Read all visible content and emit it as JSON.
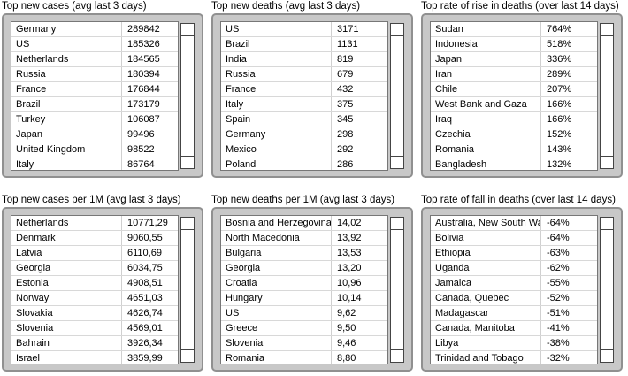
{
  "panels": [
    {
      "title": "Top new cases (avg last 3 days)",
      "rows": [
        [
          "Germany",
          "289842"
        ],
        [
          "US",
          "185326"
        ],
        [
          "Netherlands",
          "184565"
        ],
        [
          "Russia",
          "180394"
        ],
        [
          "France",
          "176844"
        ],
        [
          "Brazil",
          "173179"
        ],
        [
          "Turkey",
          "106087"
        ],
        [
          "Japan",
          "99496"
        ],
        [
          "United Kingdom",
          "98522"
        ],
        [
          "Italy",
          "86764"
        ]
      ]
    },
    {
      "title": "Top new deaths (avg last 3 days)",
      "rows": [
        [
          "US",
          "3171"
        ],
        [
          "Brazil",
          "1131"
        ],
        [
          "India",
          "819"
        ],
        [
          "Russia",
          "679"
        ],
        [
          "France",
          "432"
        ],
        [
          "Italy",
          "375"
        ],
        [
          "Spain",
          "345"
        ],
        [
          "Germany",
          "298"
        ],
        [
          "Mexico",
          "292"
        ],
        [
          "Poland",
          "286"
        ]
      ]
    },
    {
      "title": "Top rate of rise in deaths (over last 14 days)",
      "rows": [
        [
          "Sudan",
          "764%"
        ],
        [
          "Indonesia",
          "518%"
        ],
        [
          "Japan",
          "336%"
        ],
        [
          "Iran",
          "289%"
        ],
        [
          "Chile",
          "207%"
        ],
        [
          "West Bank and Gaza",
          "166%"
        ],
        [
          "Iraq",
          "166%"
        ],
        [
          "Czechia",
          "152%"
        ],
        [
          "Romania",
          "143%"
        ],
        [
          "Bangladesh",
          "132%"
        ]
      ]
    },
    {
      "title": "Top new cases per 1M (avg last 3 days)",
      "rows": [
        [
          "Netherlands",
          "10771,29"
        ],
        [
          "Denmark",
          "9060,55"
        ],
        [
          "Latvia",
          "6110,69"
        ],
        [
          "Georgia",
          "6034,75"
        ],
        [
          "Estonia",
          "4908,51"
        ],
        [
          "Norway",
          "4651,03"
        ],
        [
          "Slovakia",
          "4626,74"
        ],
        [
          "Slovenia",
          "4569,01"
        ],
        [
          "Bahrain",
          "3926,34"
        ],
        [
          "Israel",
          "3859,99"
        ]
      ]
    },
    {
      "title": "Top new deaths per 1M (avg last 3 days)",
      "rows": [
        [
          "Bosnia and Herzegovina",
          "14,02"
        ],
        [
          "North Macedonia",
          "13,92"
        ],
        [
          "Bulgaria",
          "13,53"
        ],
        [
          "Georgia",
          "13,20"
        ],
        [
          "Croatia",
          "10,96"
        ],
        [
          "Hungary",
          "10,14"
        ],
        [
          "US",
          "9,62"
        ],
        [
          "Greece",
          "9,50"
        ],
        [
          "Slovenia",
          "9,46"
        ],
        [
          "Romania",
          "8,80"
        ]
      ]
    },
    {
      "title": "Top rate of fall in deaths (over last 14 days)",
      "rows": [
        [
          "Australia, New South Wales",
          "-64%"
        ],
        [
          "Bolivia",
          "-64%"
        ],
        [
          "Ethiopia",
          "-63%"
        ],
        [
          "Uganda",
          "-62%"
        ],
        [
          "Jamaica",
          "-55%"
        ],
        [
          "Canada, Quebec",
          "-52%"
        ],
        [
          "Madagascar",
          "-51%"
        ],
        [
          "Canada, Manitoba",
          "-41%"
        ],
        [
          "Libya",
          "-38%"
        ],
        [
          "Trinidad and Tobago",
          "-32%"
        ]
      ]
    }
  ]
}
